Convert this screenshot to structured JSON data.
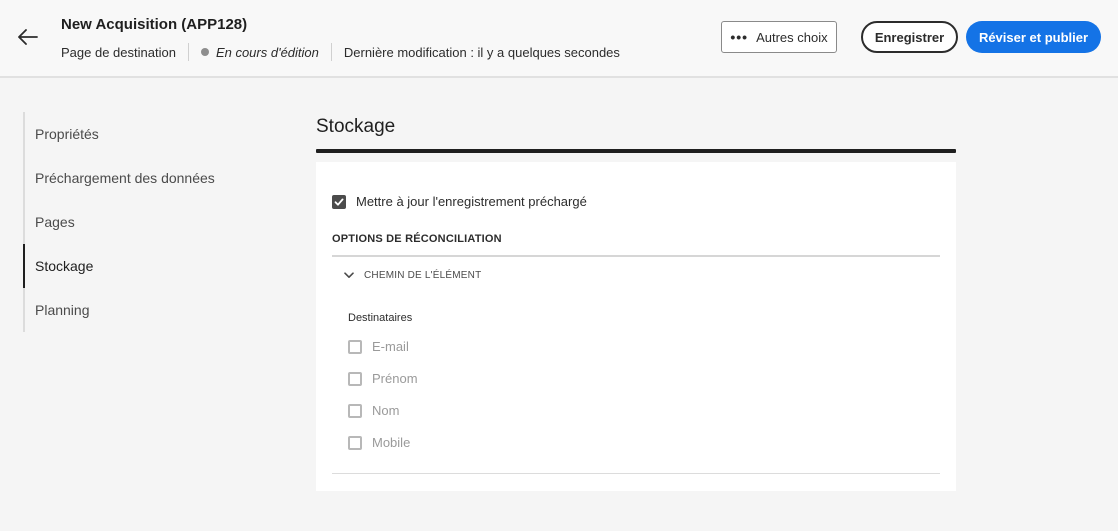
{
  "header": {
    "title": "New Acquisition (APP128)",
    "type_label": "Page de destination",
    "status": "En cours d'édition",
    "last_modified": "Dernière modification : il y a quelques secondes",
    "more_label": "Autres choix",
    "save_label": "Enregistrer",
    "publish_label": "Réviser et publier"
  },
  "sidebar": {
    "items": [
      {
        "label": "Propriétés"
      },
      {
        "label": "Préchargement des données"
      },
      {
        "label": "Pages"
      },
      {
        "label": "Stockage",
        "active": true
      },
      {
        "label": "Planning"
      }
    ]
  },
  "main": {
    "section_title": "Stockage",
    "update_checkbox_label": "Mettre à jour l'enregistrement préchargé",
    "update_checked": true,
    "reconciliation_heading": "OPTIONS DE RÉCONCILIATION",
    "accordion_label": "CHEMIN DE L'ÉLÉMENT",
    "group_label": "Destinataires",
    "fields": [
      {
        "label": "E-mail",
        "checked": false
      },
      {
        "label": "Prénom",
        "checked": false
      },
      {
        "label": "Nom",
        "checked": false
      },
      {
        "label": "Mobile",
        "checked": false
      }
    ]
  },
  "colors": {
    "accent": "#1473e6",
    "text": "#2c2c2c",
    "disabled": "#9a9a9a"
  }
}
